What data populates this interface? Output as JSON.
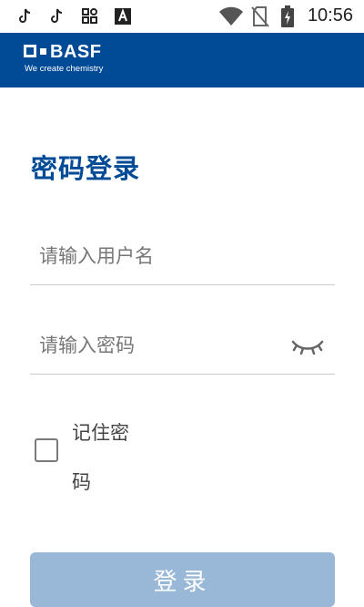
{
  "status_bar": {
    "time": "10:56",
    "icons": [
      "tiktok-icon",
      "tiktok-icon",
      "apps-icon",
      "font-a-icon",
      "wifi-icon",
      "no-sim-icon",
      "battery-charging-icon"
    ]
  },
  "brand": {
    "name": "BASF",
    "tagline": "We create chemistry",
    "color": "#004A96"
  },
  "login": {
    "title": "密码登录",
    "username_placeholder": "请输入用户名",
    "password_placeholder": "请输入密码",
    "password_visibility_icon": "eye-closed-icon",
    "remember_label": "记住密码",
    "remember_checked": false,
    "submit_label": "登录",
    "submit_color": "#99B7D6"
  }
}
